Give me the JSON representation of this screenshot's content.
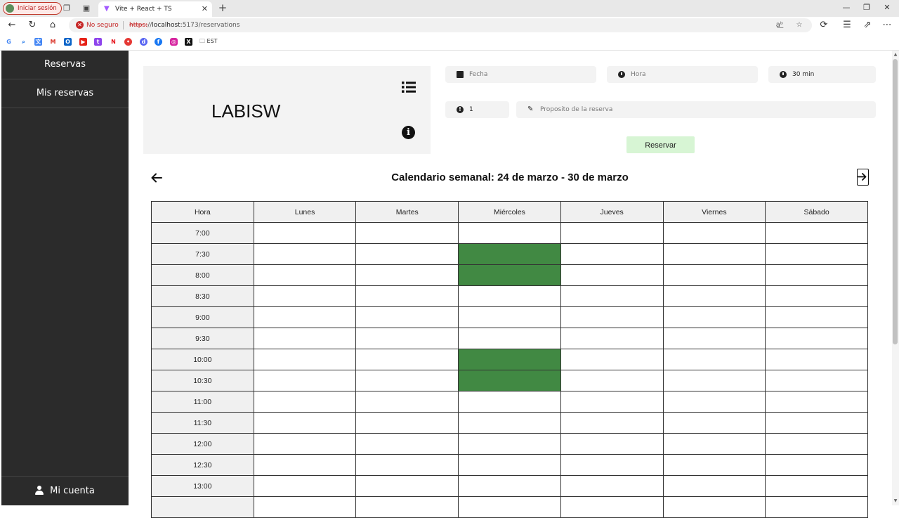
{
  "browser": {
    "signin_label": "Iniciar sesión",
    "tab_title": "Vite + React + TS",
    "security_label": "No seguro",
    "url_scheme": "https:",
    "url_sep": "//",
    "url_host": "localhost",
    "url_rest": ":5173/reservations",
    "bookmark_folder": "EST",
    "bookmarks": [
      "google",
      "search",
      "translate",
      "gmail",
      "outlook",
      "youtube",
      "twitch",
      "netflix",
      "app",
      "discord",
      "facebook",
      "instagram",
      "x"
    ]
  },
  "sidebar": {
    "items": [
      {
        "label": "Reservas"
      },
      {
        "label": "Mis reservas"
      }
    ],
    "account_label": "Mi cuenta"
  },
  "lab": {
    "name": "LABISW",
    "icons": [
      "list-icon",
      "info-icon"
    ]
  },
  "form": {
    "date_placeholder": "Fecha",
    "time_placeholder": "Hora",
    "duration_value": "30 min",
    "people_value": "1",
    "purpose_placeholder": "Proposito de la reserva",
    "reserve_label": "Reservar"
  },
  "calendar": {
    "title": "Calendario semanal: 24 de marzo - 30 de marzo",
    "headers": [
      "Hora",
      "Lunes",
      "Martes",
      "Miércoles",
      "Jueves",
      "Viernes",
      "Sábado"
    ],
    "hours": [
      "7:00",
      "7:30",
      "8:00",
      "8:30",
      "9:00",
      "9:30",
      "10:00",
      "10:30",
      "11:00",
      "11:30",
      "12:00",
      "12:30",
      "13:00",
      ""
    ],
    "booked": [
      {
        "day": "Miércoles",
        "hour": "7:30"
      },
      {
        "day": "Miércoles",
        "hour": "8:00"
      },
      {
        "day": "Miércoles",
        "hour": "10:00"
      },
      {
        "day": "Miércoles",
        "hour": "10:30"
      }
    ],
    "booked_color": "#418943"
  },
  "colors": {
    "sidebar_bg": "#2b2b2b",
    "reserve_button_bg": "#d7f5d4",
    "booked": "#418943",
    "insecure": "#c62828"
  }
}
